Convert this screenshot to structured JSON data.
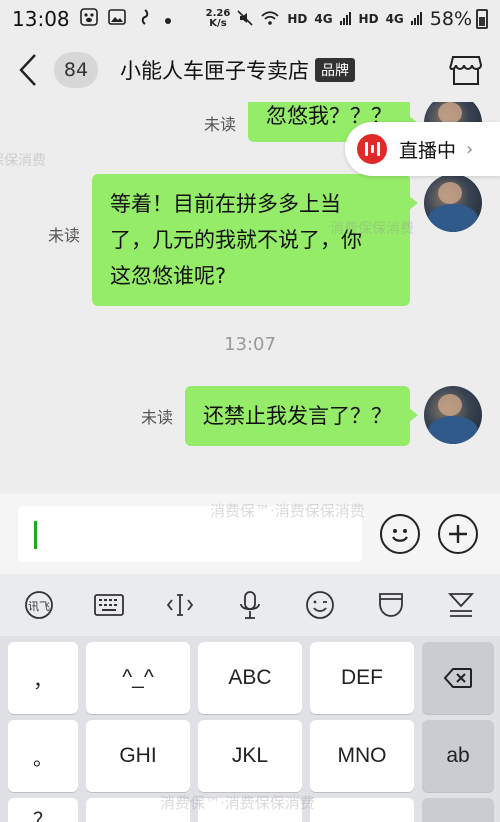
{
  "status_bar": {
    "time": "13:08",
    "net_speed_value": "2.26",
    "net_speed_unit": "K/s",
    "hd1": "HD",
    "net1": "4G",
    "hd2": "HD",
    "net2": "4G",
    "battery": "58%"
  },
  "header": {
    "unread_count": "84",
    "title": "小能人车匣子专卖店",
    "brand_tag": "品牌"
  },
  "live": {
    "label": "直播中",
    "arrow": "›"
  },
  "messages": [
    {
      "unread_label": "未读",
      "text": "忽悠我？？？"
    },
    {
      "unread_label": "未读",
      "lines": [
        "等着！目前在拼多多上当",
        "了，几元的我就不说了，你",
        "这忽悠谁呢?"
      ]
    },
    {
      "unread_label": "未读",
      "text": "还禁止我发言了？？"
    }
  ],
  "timestamp": "13:07",
  "input": {
    "value": ""
  },
  "keyboard": {
    "left_keys": [
      "，",
      "。",
      "？"
    ],
    "row1": [
      "^_^",
      "ABC",
      "DEF"
    ],
    "row2": [
      "GHI",
      "JKL",
      "MNO"
    ],
    "ab_label": "ab"
  },
  "watermark": [
    "消费保™·消费保保消费",
    "消费保™·消费保保消费",
    "保保消费",
    "消费保保消费"
  ],
  "icons": {
    "back": "chevron-left-icon",
    "store": "store-icon",
    "emoji": "emoji-icon",
    "add": "plus-icon",
    "backspace": "backspace-icon"
  },
  "colors": {
    "bubble": "#95ec69",
    "live_red": "#e02a2a",
    "caret": "#1aad19"
  }
}
